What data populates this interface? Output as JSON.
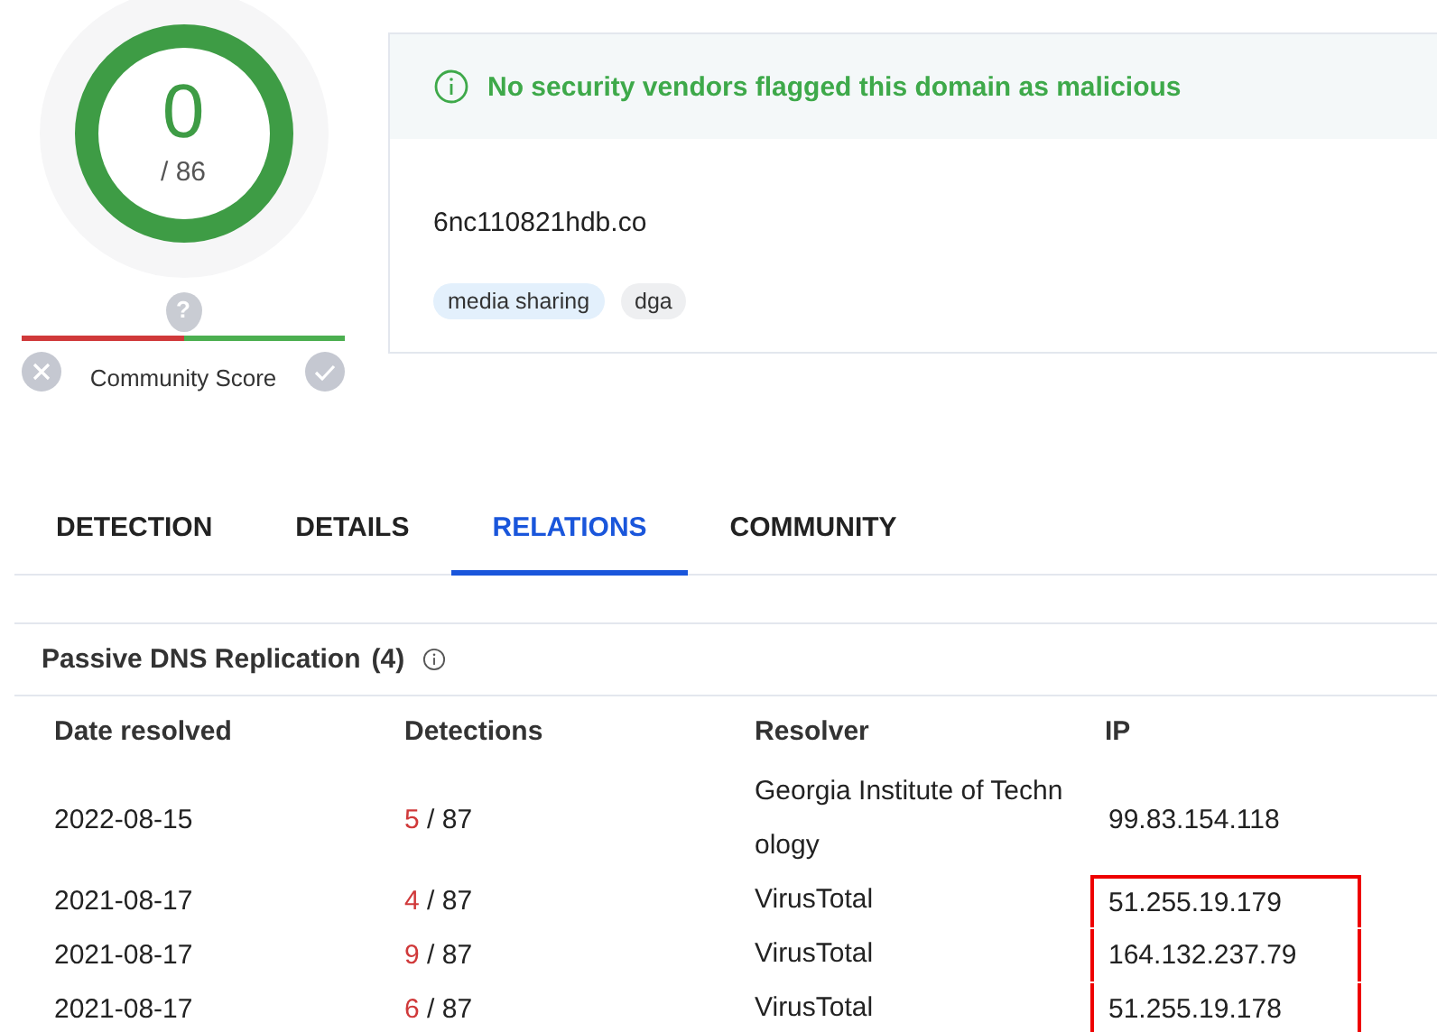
{
  "score": {
    "value": "0",
    "total": "/ 86"
  },
  "community": {
    "label": "Community Score",
    "pin": "?"
  },
  "banner": {
    "message": "No security vendors flagged this domain as malicious"
  },
  "domain": "6nc110821hdb.co",
  "tags": [
    {
      "label": "media sharing",
      "kind": "category"
    },
    {
      "label": "dga",
      "kind": "plain"
    }
  ],
  "tabs": [
    {
      "label": "DETECTION",
      "selected": false
    },
    {
      "label": "DETAILS",
      "selected": false
    },
    {
      "label": "RELATIONS",
      "selected": true
    },
    {
      "label": "COMMUNITY",
      "selected": false
    }
  ],
  "section": {
    "title": "Passive DNS Replication",
    "count": "(4)"
  },
  "table": {
    "columns": [
      "Date resolved",
      "Detections",
      "Resolver",
      "IP"
    ],
    "rows": [
      {
        "date": "2022-08-15",
        "hits": "5",
        "total": "/ 87",
        "resolver": "Georgia Institute of Technology",
        "ip": "99.83.154.118",
        "highlighted": false
      },
      {
        "date": "2021-08-17",
        "hits": "4",
        "total": "/ 87",
        "resolver": "VirusTotal",
        "ip": "51.255.19.179",
        "highlighted": true
      },
      {
        "date": "2021-08-17",
        "hits": "9",
        "total": "/ 87",
        "resolver": "VirusTotal",
        "ip": "164.132.237.79",
        "highlighted": true
      },
      {
        "date": "2021-08-17",
        "hits": "6",
        "total": "/ 87",
        "resolver": "VirusTotal",
        "ip": "51.255.19.178",
        "highlighted": true
      }
    ]
  }
}
